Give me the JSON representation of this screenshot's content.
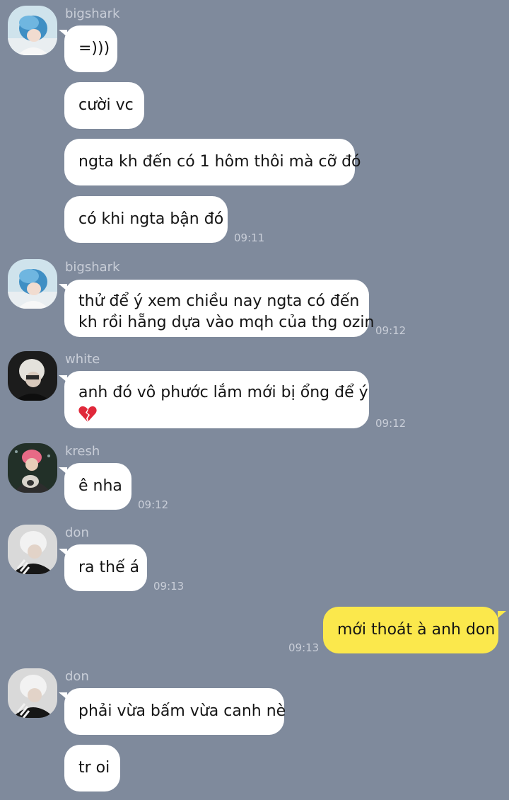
{
  "chat": {
    "colors": {
      "background": "#7f8a9c",
      "incoming_bubble": "#ffffff",
      "outgoing_bubble": "#fbe84c",
      "meta_text": "#c9ced8"
    },
    "groups": [
      {
        "sender": "bigshark",
        "avatar": "bigshark-avatar",
        "messages": [
          {
            "text": "=)))"
          },
          {
            "text": "cười vc"
          },
          {
            "text": "ngta kh đến có 1 hôm thôi mà cỡ đó"
          },
          {
            "text": "có khi ngta bận đó",
            "time": "09:11"
          }
        ]
      },
      {
        "sender": "bigshark",
        "avatar": "bigshark-avatar",
        "messages": [
          {
            "lines": [
              "thử để ý xem chiều nay ngta có đến",
              "kh rồi hẵng dựa vào mqh của thg ozin"
            ],
            "time": "09:12"
          }
        ]
      },
      {
        "sender": "white",
        "avatar": "white-avatar",
        "messages": [
          {
            "lines": [
              "anh đó vô phước lắm mới bị ổng để ý"
            ],
            "icon": "broken-heart-emoji",
            "time": "09:12"
          }
        ]
      },
      {
        "sender": "kresh",
        "avatar": "kresh-avatar",
        "messages": [
          {
            "text": "ê nha",
            "time": "09:12"
          }
        ]
      },
      {
        "sender": "don",
        "avatar": "don-avatar",
        "messages": [
          {
            "text": "ra thế á",
            "time": "09:13"
          }
        ]
      },
      {
        "outgoing": true,
        "messages": [
          {
            "text": "mới thoát à anh don",
            "time": "09:13"
          }
        ]
      },
      {
        "sender": "don",
        "avatar": "don-avatar",
        "messages": [
          {
            "text": "phải vừa bấm vừa canh nè"
          },
          {
            "text": "tr oi"
          }
        ]
      }
    ]
  }
}
